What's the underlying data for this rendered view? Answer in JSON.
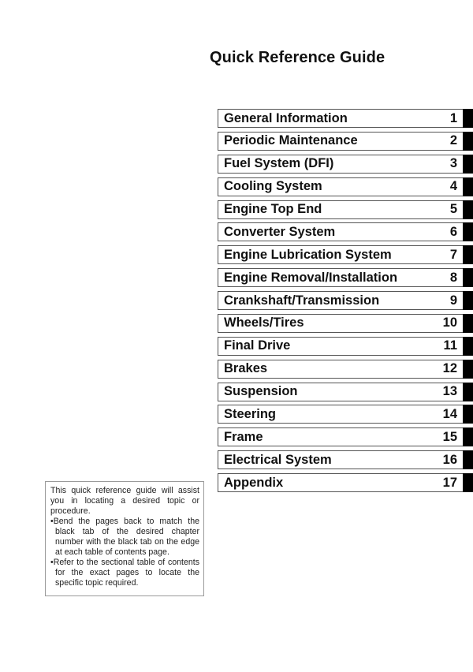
{
  "page": {
    "title": "Quick Reference Guide"
  },
  "toc": {
    "items": [
      {
        "label": "General Information",
        "number": "1"
      },
      {
        "label": "Periodic Maintenance",
        "number": "2"
      },
      {
        "label": "Fuel System (DFI)",
        "number": "3"
      },
      {
        "label": "Cooling System",
        "number": "4"
      },
      {
        "label": "Engine Top End",
        "number": "5"
      },
      {
        "label": "Converter System",
        "number": "6"
      },
      {
        "label": "Engine Lubrication System",
        "number": "7"
      },
      {
        "label": "Engine Removal/Installation",
        "number": "8"
      },
      {
        "label": "Crankshaft/Transmission",
        "number": "9"
      },
      {
        "label": "Wheels/Tires",
        "number": "10"
      },
      {
        "label": "Final Drive",
        "number": "11"
      },
      {
        "label": "Brakes",
        "number": "12"
      },
      {
        "label": "Suspension",
        "number": "13"
      },
      {
        "label": "Steering",
        "number": "14"
      },
      {
        "label": "Frame",
        "number": "15"
      },
      {
        "label": "Electrical System",
        "number": "16"
      },
      {
        "label": "Appendix",
        "number": "17"
      }
    ]
  },
  "note": {
    "intro": "This quick reference guide will assist you in locating a desired topic or procedure.",
    "bullets": [
      "•Bend the pages back to match the black tab of the desired chapter number with the black tab on the edge at each table of contents page.",
      "•Refer to the sectional table of contents for the exact pages to locate the specific topic required."
    ]
  },
  "colors": {
    "tab": "#000000",
    "box_border": "#555555",
    "note_border": "#9a9a9a"
  }
}
